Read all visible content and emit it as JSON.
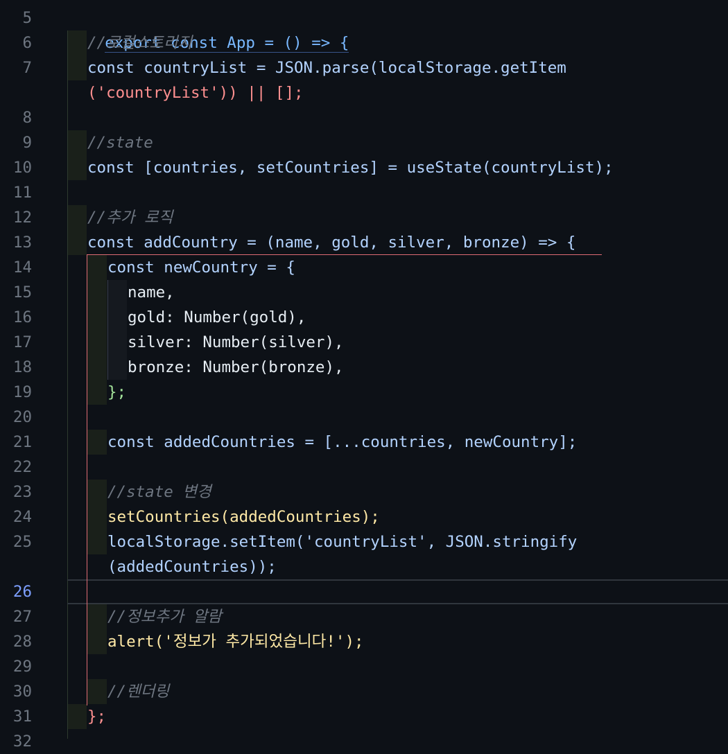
{
  "editor": {
    "active_line": 26,
    "lines": [
      {
        "num": "5",
        "text": "export const App = () => {"
      },
      {
        "num": "6",
        "text": "//로컬스토리지"
      },
      {
        "num": "7",
        "text": "const countryList = JSON.parse(localStorage.getItem"
      },
      {
        "num": "",
        "text": "('countryList')) || [];"
      },
      {
        "num": "8",
        "text": ""
      },
      {
        "num": "9",
        "text": "//state"
      },
      {
        "num": "10",
        "text": "const [countries, setCountries] = useState(countryList);"
      },
      {
        "num": "11",
        "text": ""
      },
      {
        "num": "12",
        "text": "//추가 로직"
      },
      {
        "num": "13",
        "text": "const addCountry = (name, gold, silver, bronze) => {"
      },
      {
        "num": "14",
        "text": "const newCountry = {"
      },
      {
        "num": "15",
        "text": "name,"
      },
      {
        "num": "16",
        "text": "gold: Number(gold),"
      },
      {
        "num": "17",
        "text": "silver: Number(silver),"
      },
      {
        "num": "18",
        "text": "bronze: Number(bronze),"
      },
      {
        "num": "19",
        "text": "};"
      },
      {
        "num": "20",
        "text": ""
      },
      {
        "num": "21",
        "text": "const addedCountries = [...countries, newCountry];"
      },
      {
        "num": "22",
        "text": ""
      },
      {
        "num": "23",
        "text": "//state 변경"
      },
      {
        "num": "24",
        "text": "setCountries(addedCountries);"
      },
      {
        "num": "25",
        "text": "localStorage.setItem('countryList', JSON.stringify"
      },
      {
        "num": "",
        "text": "(addedCountries));"
      },
      {
        "num": "26",
        "text": ""
      },
      {
        "num": "27",
        "text": "//정보추가 알람"
      },
      {
        "num": "28",
        "text": "alert('정보가 추가되었습니다!');"
      },
      {
        "num": "29",
        "text": ""
      },
      {
        "num": "30",
        "text": "//렌더링"
      },
      {
        "num": "31",
        "text": "};"
      },
      {
        "num": "32",
        "text": ""
      }
    ]
  }
}
